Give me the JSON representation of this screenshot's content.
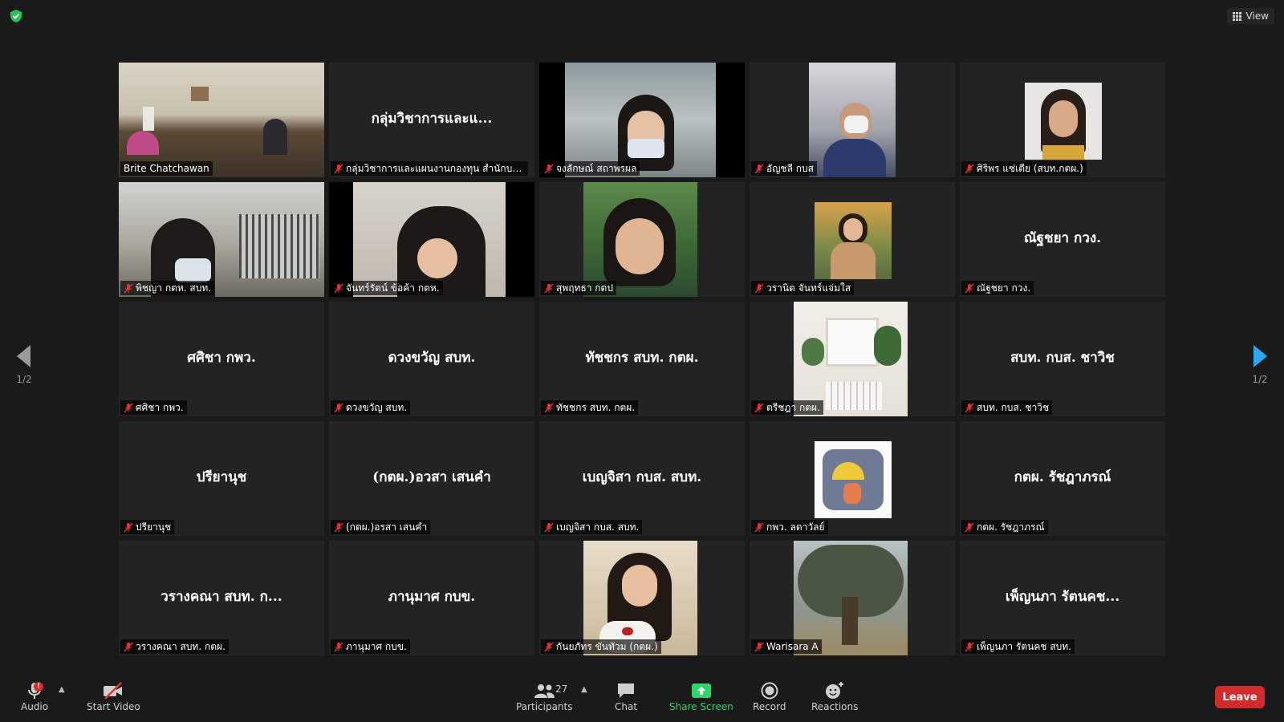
{
  "top": {
    "view_label": "View"
  },
  "pagination": {
    "left": "1/2",
    "right": "1/2"
  },
  "tiles": [
    {
      "name": "Brite Chatchawan",
      "center": ""
    },
    {
      "name": "กลุ่มวิชาการและแผนงานกองทุน สำนักบริหาร...",
      "center": "กลุ่มวิชาการและแ..."
    },
    {
      "name": "จงลักษณ์ สถาพรผล",
      "center": ""
    },
    {
      "name": "อัญชลี กบส",
      "center": ""
    },
    {
      "name": "ศิริพร แซ่เตีย (สบท.กตผ.)",
      "center": ""
    },
    {
      "name": "พิชญา กตห. สบท.",
      "center": ""
    },
    {
      "name": "จันทร์รัตน์ ข้อค้า กตห.",
      "center": ""
    },
    {
      "name": "สุพฤทธา กตป",
      "center": ""
    },
    {
      "name": "วรานิต จันทร์แจ่มใส",
      "center": ""
    },
    {
      "name": "ณัฐชยา กวง.",
      "center": "ณัฐชยา กวง."
    },
    {
      "name": "ศศิชา กพว.",
      "center": "ศศิชา กพว."
    },
    {
      "name": "ดวงขวัญ สบท.",
      "center": "ดวงขวัญ สบท."
    },
    {
      "name": "ทัชชกร สบท. กตผ.",
      "center": "ทัชชกร สบท. กตผ."
    },
    {
      "name": "ตรีชฎา กตผ.",
      "center": ""
    },
    {
      "name": "สบท. กบส. ชาวิช",
      "center": "สบท. กบส. ชาวิช"
    },
    {
      "name": "ปรียานุช",
      "center": "ปรียานุช"
    },
    {
      "name": "(กตผ.)อรสา เสนคำ",
      "center": "(กตผ.)อวสา เสนคำ"
    },
    {
      "name": "เบญจิสา กบส. สบท.",
      "center": "เบญจิสา กบส. สบท."
    },
    {
      "name": "กพว. ลดาวัลย์",
      "center": ""
    },
    {
      "name": "กตผ. รัชฎาภรณ์",
      "center": "กตผ. รัชฎาภรณ์"
    },
    {
      "name": "วรางคณา สบท. กตผ.",
      "center": "วรางคณา สบท. ก..."
    },
    {
      "name": "ภานุมาศ กบข.",
      "center": "ภานุมาศ กบข."
    },
    {
      "name": "กันยภัทร ขันทัวม (กตผ.)",
      "center": ""
    },
    {
      "name": "Warisara A",
      "center": ""
    },
    {
      "name": "เพ็ญนภา รัตนคช สบท.",
      "center": "เพ็ญนภา รัตนคช..."
    }
  ],
  "toolbar": {
    "audio": "Audio",
    "start_video": "Start Video",
    "participants": "Participants",
    "participants_count": "27",
    "chat": "Chat",
    "share_screen": "Share Screen",
    "record": "Record",
    "reactions": "Reactions",
    "leave": "Leave",
    "audio_badge": "!"
  },
  "colors": {
    "share_green": "#2dd56a",
    "leave_red": "#d32b2b",
    "active_border": "#e7e35a",
    "nav_blue": "#2aa7f0"
  }
}
